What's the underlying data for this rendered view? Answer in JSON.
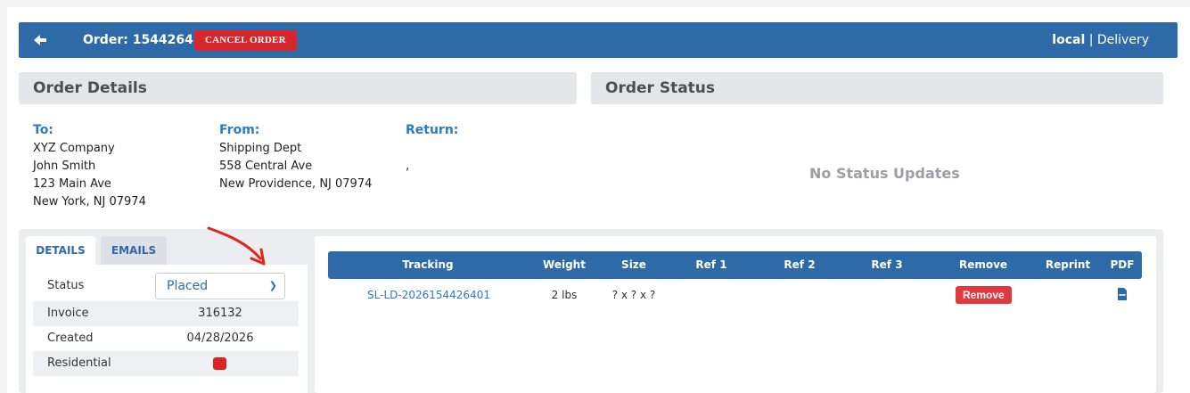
{
  "header": {
    "order_title": "Order: 1544264",
    "cancel_label": "CANCEL ORDER",
    "location": "local",
    "separator": " | ",
    "service": "Delivery"
  },
  "order_details": {
    "title": "Order Details",
    "to": {
      "label": "To:",
      "lines": [
        "XYZ Company",
        "John Smith",
        "123 Main Ave",
        "New York, NJ 07974"
      ]
    },
    "from": {
      "label": "From:",
      "lines": [
        "Shipping Dept",
        "558 Central Ave",
        "New Providence, NJ 07974"
      ]
    },
    "return": {
      "label": "Return:",
      "lines": [
        "",
        ","
      ]
    }
  },
  "order_status": {
    "title": "Order Status",
    "empty_text": "No Status Updates"
  },
  "tabs": {
    "details": "DETAILS",
    "emails": "EMAILS"
  },
  "details": {
    "status_label": "Status",
    "status_value": "Placed",
    "invoice_label": "Invoice",
    "invoice_value": "316132",
    "created_label": "Created",
    "created_value": "04/28/2026",
    "residential_label": "Residential"
  },
  "packages": {
    "headers": [
      "Tracking",
      "Weight",
      "Size",
      "Ref 1",
      "Ref 2",
      "Ref 3",
      "Remove",
      "Reprint",
      "PDF"
    ],
    "rows": [
      {
        "tracking": "SL-LD-2026154426401",
        "weight": "2 lbs",
        "size": "? x ? x ?",
        "ref1": "",
        "ref2": "",
        "ref3": "",
        "remove_label": "Remove"
      }
    ]
  },
  "colors": {
    "header": "#2e6aa8",
    "danger": "#d9262c",
    "link": "#2e7bbf"
  },
  "icons": {
    "back": "arrow-left-icon",
    "pdf": "pdf-file-icon",
    "select": "chevron-down-icon"
  }
}
